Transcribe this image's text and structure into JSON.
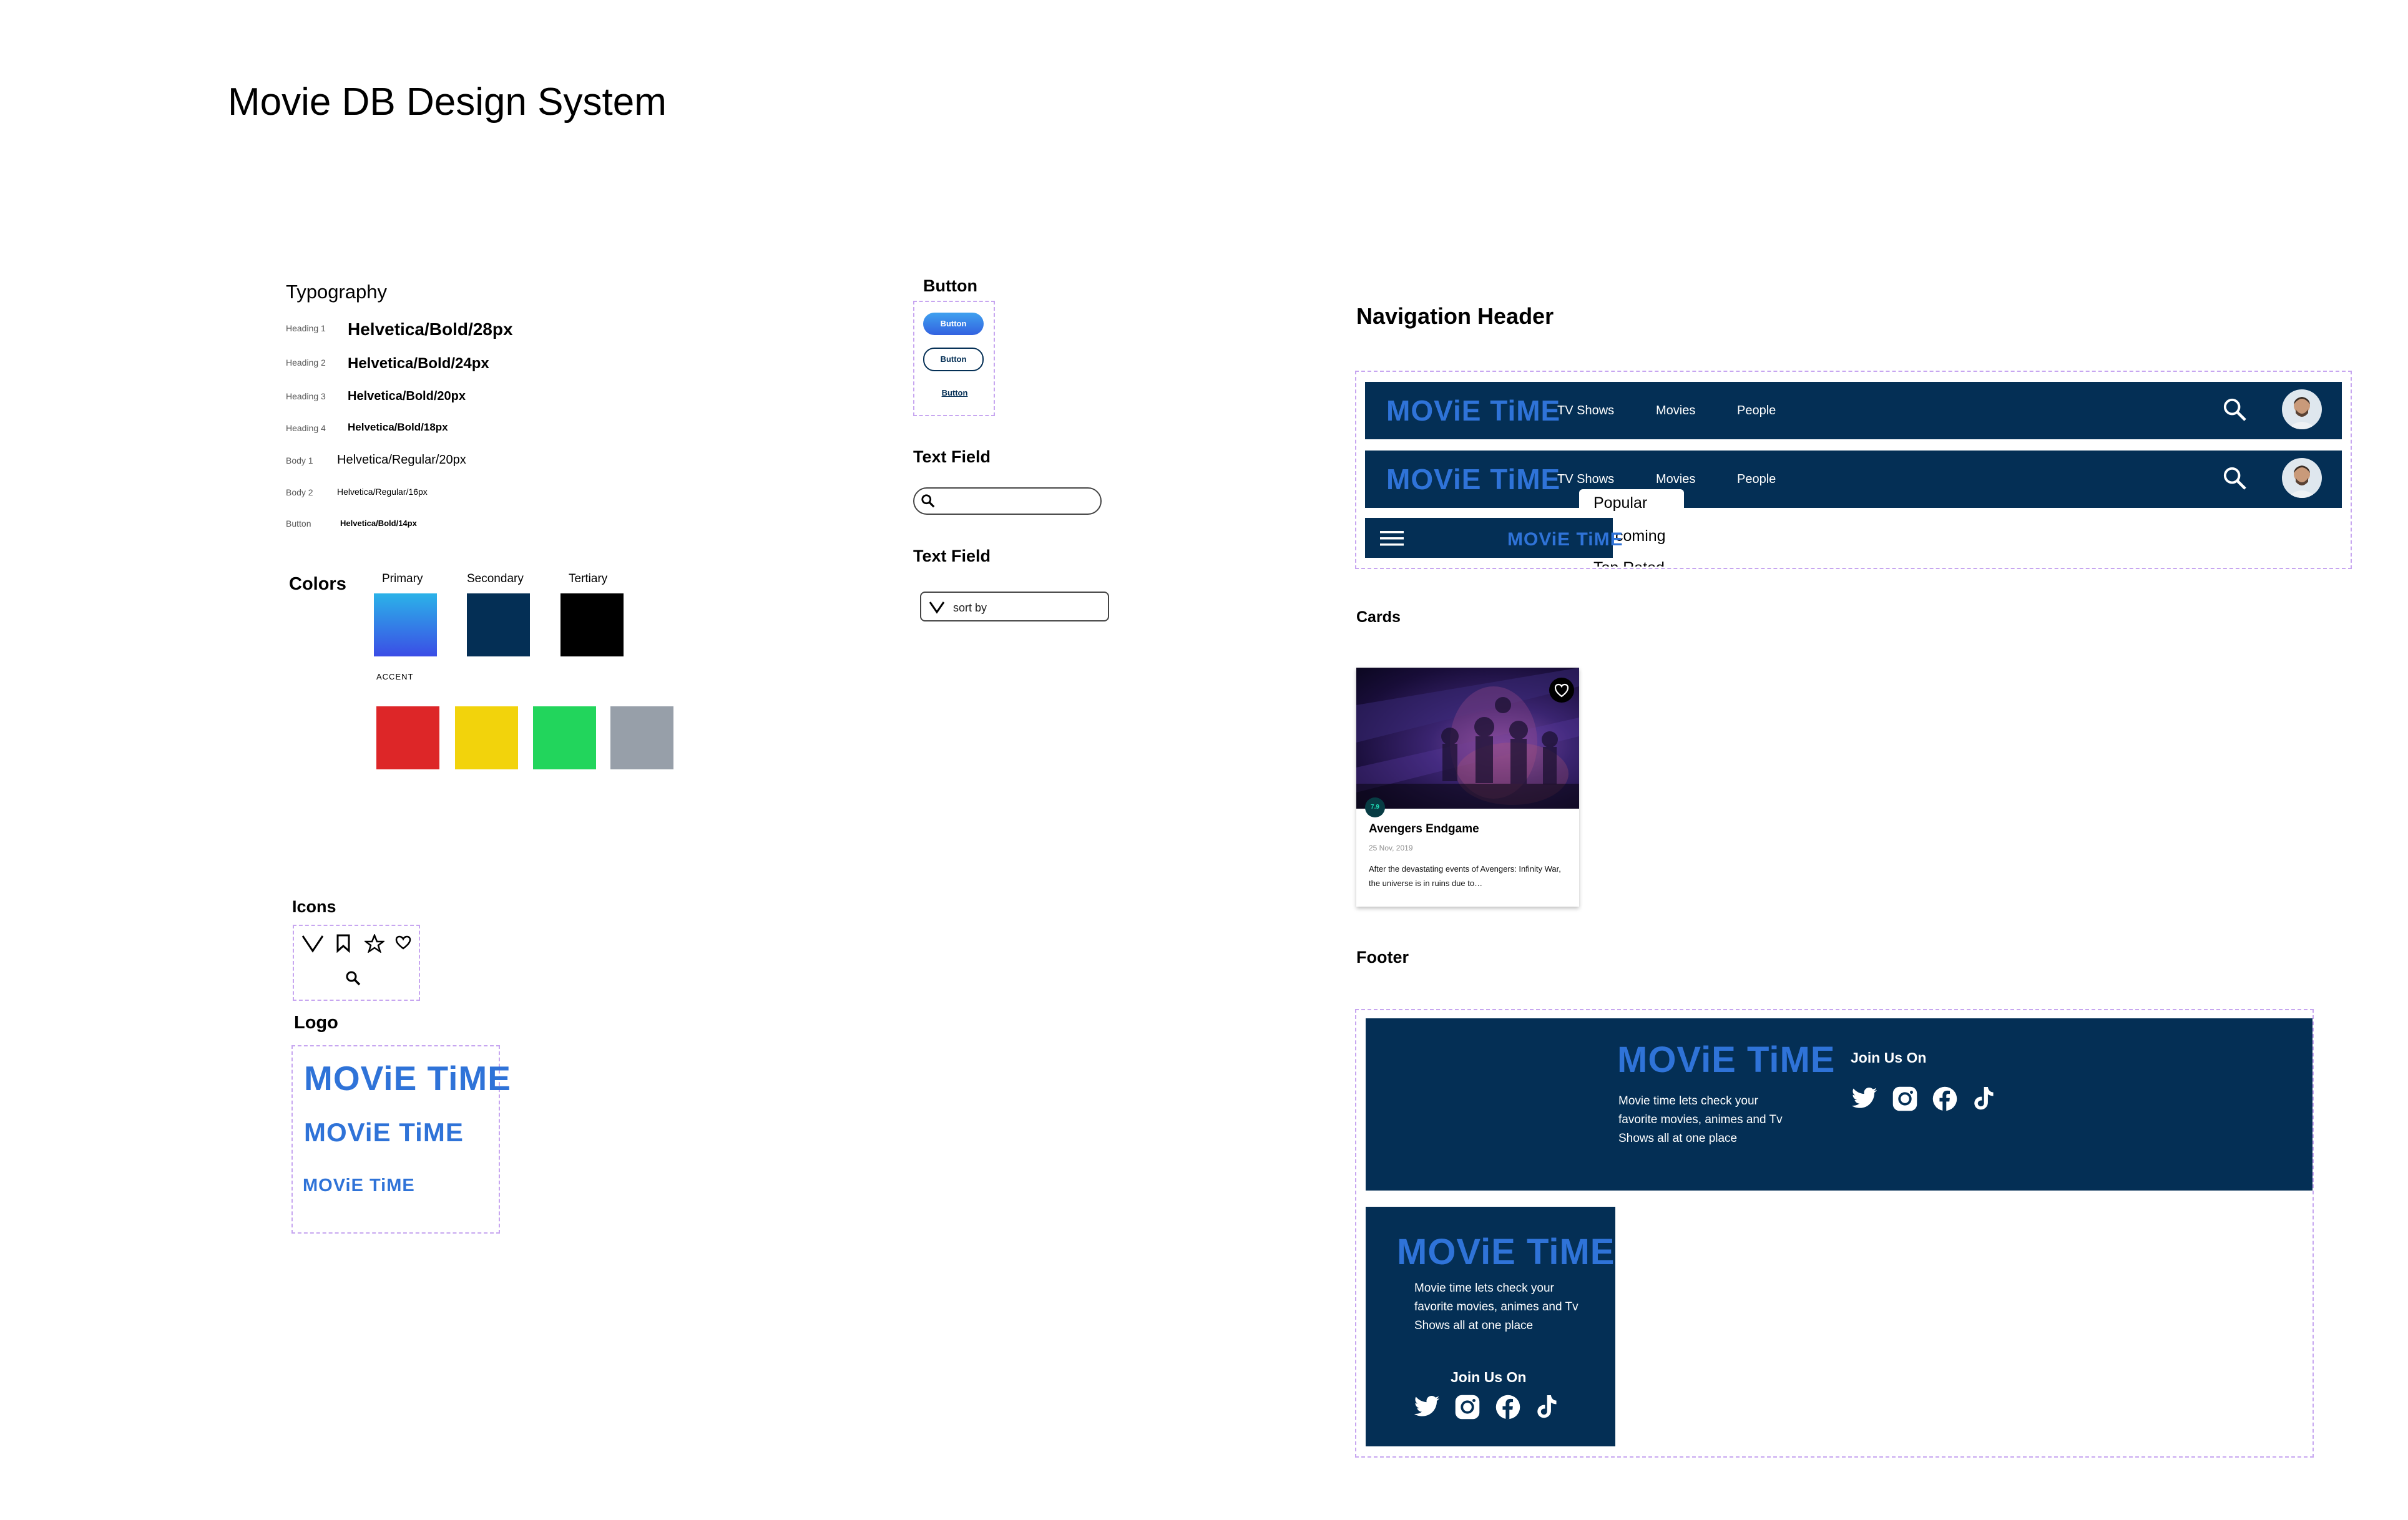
{
  "page": {
    "title": "Movie DB Design System"
  },
  "typography": {
    "title": "Typography",
    "rows": [
      {
        "label": "Heading 1",
        "spec": "Helvetica/Bold/28px"
      },
      {
        "label": "Heading 2",
        "spec": "Helvetica/Bold/24px"
      },
      {
        "label": "Heading 3",
        "spec": "Helvetica/Bold/20px"
      },
      {
        "label": "Heading 4",
        "spec": "Helvetica/Bold/18px"
      },
      {
        "label": "Body 1",
        "spec": "Helvetica/Regular/20px"
      },
      {
        "label": "Body 2",
        "spec": "Helvetica/Regular/16px"
      },
      {
        "label": "Button",
        "spec": "Helvetica/Bold/14px"
      }
    ]
  },
  "colors": {
    "title": "Colors",
    "labels": {
      "primary": "Primary",
      "secondary": "Secondary",
      "tertiary": "Tertiary",
      "accent": "ACCENT"
    },
    "primary_gradient": [
      "#2bb3e8",
      "#3b4de6"
    ],
    "secondary": "#042f55",
    "tertiary": "#000000",
    "accents": [
      "#dd2628",
      "#f2d30c",
      "#22d55c",
      "#979fa9"
    ]
  },
  "icons": {
    "title": "Icons",
    "items": [
      "chevron-down-icon",
      "bookmark-icon",
      "star-icon",
      "heart-icon",
      "search-icon"
    ]
  },
  "logo_section": {
    "title": "Logo",
    "brand": "MOViE TiME"
  },
  "button_section": {
    "title": "Button",
    "label": "Button"
  },
  "text_field_1": {
    "title": "Text Field",
    "value": ""
  },
  "text_field_2": {
    "title": "Text Field",
    "placeholder": "sort by"
  },
  "nav_header": {
    "title": "Navigation Header",
    "links": [
      "TV Shows",
      "Movies",
      "People"
    ],
    "dropdown": [
      "Popular",
      "coming",
      "Top Rated"
    ]
  },
  "cards": {
    "title": "Cards",
    "movie_title": "Avengers Endgame",
    "date": "25 Nov, 2019",
    "rating": "7.9",
    "description": "After the devastating events of Avengers: Infinity War, the universe is in ruins due to…"
  },
  "footer": {
    "title": "Footer",
    "tagline": "Movie time lets check your favorite movies, animes and Tv Shows all at one place",
    "join_label": "Join Us On",
    "socials": [
      "twitter-icon",
      "instagram-icon",
      "facebook-icon",
      "tiktok-icon"
    ]
  },
  "theme": {
    "navy": "#042f55",
    "logo_blue": "#2f73d8",
    "dash": "#c7a6f0"
  }
}
